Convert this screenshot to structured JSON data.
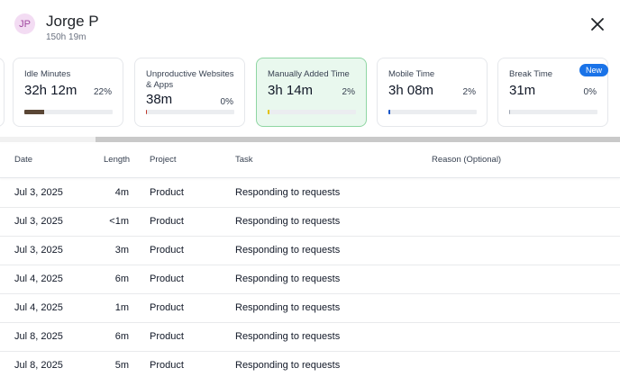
{
  "header": {
    "avatar_initials": "JP",
    "user_name": "Jorge P",
    "total_time": "150h 19m"
  },
  "cards": [
    {
      "title": "Idle Minutes",
      "value": "32h 12m",
      "percent": "22%",
      "fill_percent": 22,
      "fill_color": "#5a4635",
      "active": false
    },
    {
      "title": "Unproductive Websites & Apps",
      "value": "38m",
      "percent": "0%",
      "fill_percent": 0,
      "fill_color": "#c0392b",
      "active": false
    },
    {
      "title": "Manually Added Time",
      "value": "3h 14m",
      "percent": "2%",
      "fill_percent": 2,
      "fill_color": "#e3c200",
      "active": true
    },
    {
      "title": "Mobile Time",
      "value": "3h 08m",
      "percent": "2%",
      "fill_percent": 2,
      "fill_color": "#1a56c8",
      "active": false
    },
    {
      "title": "Break Time",
      "value": "31m",
      "percent": "0%",
      "fill_percent": 0,
      "fill_color": "#9ca3af",
      "active": false,
      "badge": "New"
    }
  ],
  "table": {
    "columns": {
      "date": "Date",
      "length": "Length",
      "project": "Project",
      "task": "Task",
      "reason": "Reason (Optional)"
    },
    "rows": [
      {
        "date": "Jul 3, 2025",
        "length": "4m",
        "project": "Product",
        "task": "Responding to requests"
      },
      {
        "date": "Jul 3, 2025",
        "length": "<1m",
        "project": "Product",
        "task": "Responding to requests"
      },
      {
        "date": "Jul 3, 2025",
        "length": "3m",
        "project": "Product",
        "task": "Responding to requests"
      },
      {
        "date": "Jul 4, 2025",
        "length": "6m",
        "project": "Product",
        "task": "Responding to requests"
      },
      {
        "date": "Jul 4, 2025",
        "length": "1m",
        "project": "Product",
        "task": "Responding to requests"
      },
      {
        "date": "Jul 8, 2025",
        "length": "6m",
        "project": "Product",
        "task": "Responding to requests"
      },
      {
        "date": "Jul 8, 2025",
        "length": "5m",
        "project": "Product",
        "task": "Responding to requests"
      }
    ]
  }
}
